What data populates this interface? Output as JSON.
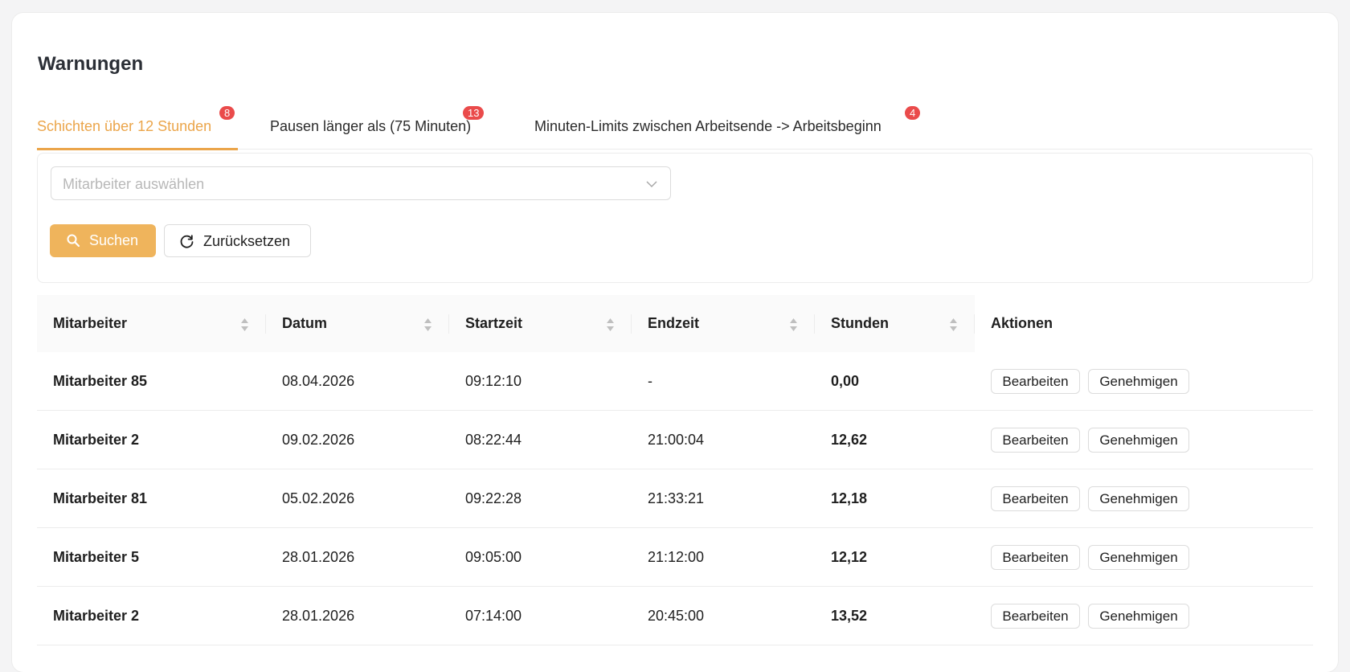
{
  "page": {
    "title": "Warnungen"
  },
  "tabs": [
    {
      "label": "Schichten über 12 Stunden",
      "badge": "8",
      "active": true
    },
    {
      "label": "Pausen länger als (75 Minuten)",
      "badge": "13",
      "active": false
    },
    {
      "label": "Minuten-Limits zwischen Arbeitsende -> Arbeitsbeginn",
      "badge": "4",
      "active": false
    }
  ],
  "filter": {
    "employee_placeholder": "Mitarbeiter auswählen",
    "search_label": "Suchen",
    "reset_label": "Zurücksetzen"
  },
  "table": {
    "columns": [
      "Mitarbeiter",
      "Datum",
      "Startzeit",
      "Endzeit",
      "Stunden",
      "Aktionen"
    ],
    "rows": [
      {
        "employee": "Mitarbeiter 85",
        "date": "08.04.2026",
        "start": "09:12:10",
        "end": "-",
        "hours": "0,00",
        "edit": "Bearbeiten",
        "approve": "Genehmigen"
      },
      {
        "employee": "Mitarbeiter 2",
        "date": "09.02.2026",
        "start": "08:22:44",
        "end": "21:00:04",
        "hours": "12,62",
        "edit": "Bearbeiten",
        "approve": "Genehmigen"
      },
      {
        "employee": "Mitarbeiter 81",
        "date": "05.02.2026",
        "start": "09:22:28",
        "end": "21:33:21",
        "hours": "12,18",
        "edit": "Bearbeiten",
        "approve": "Genehmigen"
      },
      {
        "employee": "Mitarbeiter 5",
        "date": "28.01.2026",
        "start": "09:05:00",
        "end": "21:12:00",
        "hours": "12,12",
        "edit": "Bearbeiten",
        "approve": "Genehmigen"
      },
      {
        "employee": "Mitarbeiter 2",
        "date": "28.01.2026",
        "start": "07:14:00",
        "end": "20:45:00",
        "hours": "13,52",
        "edit": "Bearbeiten",
        "approve": "Genehmigen"
      }
    ]
  },
  "colors": {
    "accent": "#eba54a",
    "primary_button": "#efb45c",
    "badge": "#ea4b4b"
  },
  "icons": {
    "search": "search-icon",
    "reset": "reload-icon",
    "select": "chevron-down-icon",
    "sort": "sort-icon"
  }
}
